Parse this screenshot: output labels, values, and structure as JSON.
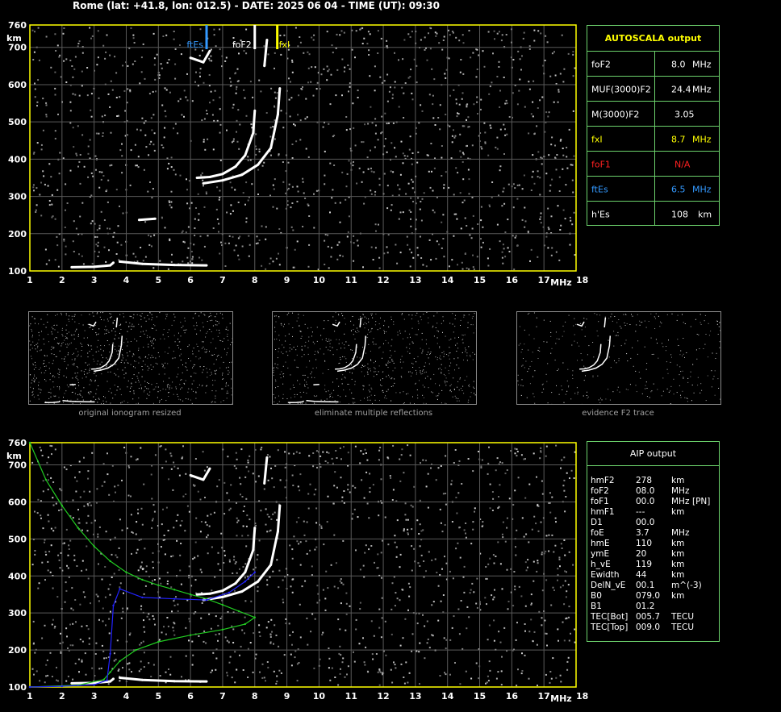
{
  "title": "Rome (lat: +41.8, lon: 012.5) - DATE: 2025 06 04 - TIME (UT): 09:30",
  "colors": {
    "yellow": "#ffff00",
    "blue": "#3399ff",
    "red": "#ff2020",
    "green": "#6cd26c",
    "grid": "#5a5a5a",
    "trace_green": "#22cc22",
    "trace_blue": "#2222ff"
  },
  "autoscala": {
    "header": "AUTOSCALA output",
    "rows": [
      {
        "label": "foF2",
        "value": "8.0",
        "unit": "MHz",
        "color": "#ffffff"
      },
      {
        "label": "MUF(3000)F2",
        "value": "24.4",
        "unit": "MHz",
        "color": "#ffffff"
      },
      {
        "label": "M(3000)F2",
        "value": "3.05",
        "unit": "",
        "color": "#ffffff"
      },
      {
        "label": "fxI",
        "value": "8.7",
        "unit": "MHz",
        "color": "#ffff00"
      },
      {
        "label": "foF1",
        "value": "N/A",
        "unit": "",
        "color": "#ff2020"
      },
      {
        "label": "ftEs",
        "value": "6.5",
        "unit": "MHz",
        "color": "#3399ff"
      },
      {
        "label": "h'Es",
        "value": "108",
        "unit": "km",
        "color": "#ffffff"
      }
    ]
  },
  "aip": {
    "header": "AIP output",
    "rows": [
      {
        "label": "hmF2",
        "value": "278",
        "unit": "km",
        "extra": ""
      },
      {
        "label": "foF2",
        "value": "08.0",
        "unit": "MHz",
        "extra": ""
      },
      {
        "label": "foF1",
        "value": "00.0",
        "unit": "MHz",
        "extra": "[PN]"
      },
      {
        "label": "hmF1",
        "value": "---",
        "unit": "km",
        "extra": ""
      },
      {
        "label": "D1",
        "value": "00.0",
        "unit": "",
        "extra": ""
      },
      {
        "label": "foE",
        "value": "3.7",
        "unit": "MHz",
        "extra": ""
      },
      {
        "label": "hmE",
        "value": "110",
        "unit": "km",
        "extra": ""
      },
      {
        "label": "ymE",
        "value": "20",
        "unit": "km",
        "extra": ""
      },
      {
        "label": "h_vE",
        "value": "119",
        "unit": "km",
        "extra": ""
      },
      {
        "label": "Ewidth",
        "value": "44",
        "unit": "km",
        "extra": ""
      },
      {
        "label": "DelN_vE",
        "value": "00.1",
        "unit": "m^(-3)",
        "extra": ""
      },
      {
        "label": "B0",
        "value": "079.0",
        "unit": "km",
        "extra": ""
      },
      {
        "label": "B1",
        "value": "01.2",
        "unit": "",
        "extra": ""
      },
      {
        "label": "TEC[Bot]",
        "value": "005.7",
        "unit": "TECU",
        "extra": ""
      },
      {
        "label": "TEC[Top]",
        "value": "009.0",
        "unit": "TECU",
        "extra": ""
      }
    ]
  },
  "thumbnails": {
    "captions": [
      "original ionogram resized",
      "eliminate multiple reflections",
      "evidence F2 trace"
    ]
  },
  "chart_data": [
    {
      "type": "scatter",
      "title": "",
      "xlabel": "MHz",
      "ylabel": "km",
      "xlim": [
        1,
        18
      ],
      "ylim": [
        100,
        760
      ],
      "x_ticks": [
        1,
        2,
        3,
        4,
        5,
        6,
        7,
        8,
        9,
        10,
        11,
        12,
        13,
        14,
        15,
        16,
        17,
        18
      ],
      "y_ticks": [
        100,
        200,
        300,
        400,
        500,
        600,
        700,
        760
      ],
      "grid": true,
      "markers": [
        {
          "name": "ftEs",
          "x": 6.5,
          "color": "#3399ff"
        },
        {
          "name": "foF2",
          "x": 8.0,
          "color": "#ffffff"
        },
        {
          "name": "fxI",
          "x": 8.7,
          "color": "#ffff00"
        }
      ],
      "series": [
        {
          "values": [
            [
              2.3,
              110
            ],
            [
              3.0,
              111
            ],
            [
              3.5,
              115
            ],
            [
              3.6,
              122
            ]
          ],
          "color": "#ffffff"
        },
        {
          "values": [
            [
              3.8,
              125
            ],
            [
              4.5,
              119
            ],
            [
              5.5,
              116
            ],
            [
              6.5,
              115
            ]
          ],
          "color": "#ffffff"
        },
        {
          "values": [
            [
              4.4,
              237
            ],
            [
              4.9,
              240
            ]
          ],
          "color": "#ffffff"
        },
        {
          "values": [
            [
              6.0,
              672
            ],
            [
              6.4,
              660
            ],
            [
              6.6,
              690
            ]
          ],
          "color": "#ffffff"
        },
        {
          "values": [
            [
              6.2,
              350
            ],
            [
              6.6,
              352
            ],
            [
              7.0,
              360
            ],
            [
              7.4,
              380
            ],
            [
              7.7,
              410
            ],
            [
              7.95,
              470
            ],
            [
              8.0,
              530
            ]
          ],
          "color": "#ffffff"
        },
        {
          "values": [
            [
              6.4,
              335
            ],
            [
              7.0,
              343
            ],
            [
              7.6,
              358
            ],
            [
              8.1,
              385
            ],
            [
              8.5,
              430
            ],
            [
              8.72,
              520
            ],
            [
              8.78,
              590
            ]
          ],
          "color": "#ffffff"
        },
        {
          "values": [
            [
              8.3,
              650
            ],
            [
              8.38,
              720
            ]
          ],
          "color": "#ffffff"
        }
      ]
    },
    {
      "type": "line",
      "title": "",
      "xlabel": "MHz",
      "ylabel": "km",
      "xlim": [
        1,
        18
      ],
      "ylim": [
        100,
        760
      ],
      "x_ticks": [
        1,
        2,
        3,
        4,
        5,
        6,
        7,
        8,
        9,
        10,
        11,
        12,
        13,
        14,
        15,
        16,
        17,
        18
      ],
      "y_ticks": [
        100,
        200,
        300,
        400,
        500,
        600,
        700,
        760
      ],
      "grid": true,
      "series": [
        {
          "values": [
            [
              2.3,
              110
            ],
            [
              3.0,
              111
            ],
            [
              3.5,
              115
            ],
            [
              3.6,
              122
            ]
          ],
          "color": "#ffffff"
        },
        {
          "values": [
            [
              3.8,
              125
            ],
            [
              4.5,
              119
            ],
            [
              5.5,
              116
            ],
            [
              6.5,
              115
            ]
          ],
          "color": "#ffffff"
        },
        {
          "values": [
            [
              6.0,
              672
            ],
            [
              6.4,
              660
            ],
            [
              6.6,
              690
            ]
          ],
          "color": "#ffffff"
        },
        {
          "values": [
            [
              6.2,
              350
            ],
            [
              6.6,
              352
            ],
            [
              7.0,
              360
            ],
            [
              7.4,
              380
            ],
            [
              7.7,
              410
            ],
            [
              7.95,
              470
            ],
            [
              8.0,
              530
            ]
          ],
          "color": "#ffffff"
        },
        {
          "values": [
            [
              6.4,
              335
            ],
            [
              7.0,
              343
            ],
            [
              7.6,
              358
            ],
            [
              8.1,
              385
            ],
            [
              8.5,
              430
            ],
            [
              8.72,
              520
            ],
            [
              8.78,
              590
            ]
          ],
          "color": "#ffffff"
        },
        {
          "values": [
            [
              8.3,
              650
            ],
            [
              8.38,
              720
            ]
          ],
          "color": "#ffffff"
        },
        {
          "values": [
            [
              1.0,
              760
            ],
            [
              1.5,
              660
            ],
            [
              2.0,
              590
            ],
            [
              2.5,
              530
            ],
            [
              3.0,
              480
            ],
            [
              3.5,
              440
            ],
            [
              4.0,
              410
            ],
            [
              4.5,
              390
            ],
            [
              5.0,
              375
            ],
            [
              5.5,
              363
            ],
            [
              6.0,
              350
            ],
            [
              6.5,
              338
            ],
            [
              7.0,
              322
            ],
            [
              7.5,
              305
            ],
            [
              8.0,
              288
            ],
            [
              7.7,
              270
            ],
            [
              7.0,
              255
            ],
            [
              6.0,
              240
            ],
            [
              5.0,
              222
            ],
            [
              4.3,
              200
            ],
            [
              3.8,
              170
            ],
            [
              3.5,
              140
            ],
            [
              3.3,
              120
            ],
            [
              2.5,
              105
            ],
            [
              1.0,
              100
            ]
          ],
          "color": "#22cc22"
        },
        {
          "values": [
            [
              1.0,
              100
            ],
            [
              2.0,
              102
            ],
            [
              3.0,
              106
            ],
            [
              3.4,
              118
            ],
            [
              3.5,
              190
            ],
            [
              3.6,
              320
            ],
            [
              3.8,
              365
            ],
            [
              4.5,
              342
            ],
            [
              5.5,
              338
            ],
            [
              6.5,
              335
            ],
            [
              7.2,
              355
            ],
            [
              7.7,
              385
            ],
            [
              8.0,
              410
            ]
          ],
          "color": "#2222ff"
        }
      ]
    }
  ]
}
